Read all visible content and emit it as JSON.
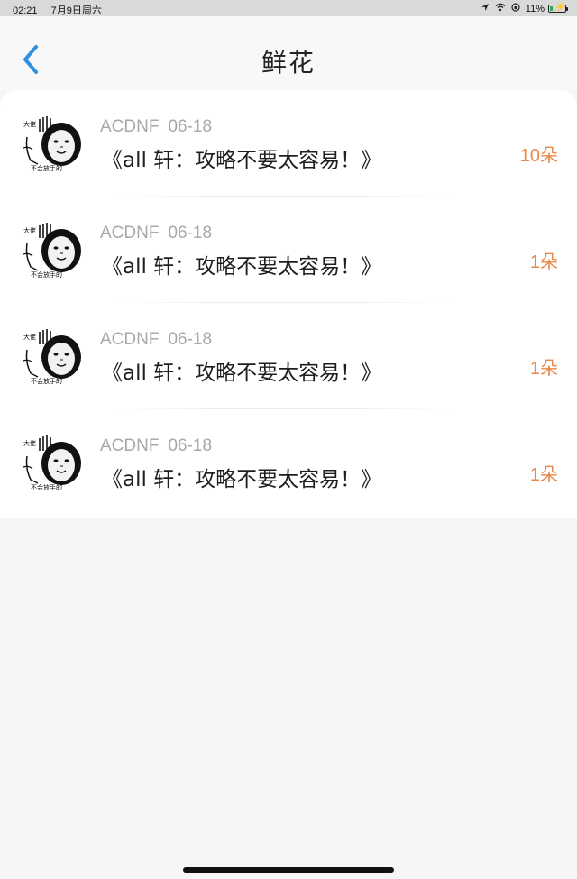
{
  "status_bar": {
    "time": "02:21",
    "date": "7月9日周六",
    "battery": "11%"
  },
  "nav": {
    "title": "鲜花"
  },
  "avatar_text": {
    "top": "大佬",
    "bottom": "不会放手的"
  },
  "items": [
    {
      "user": "ACDNF",
      "date": "06-18",
      "title": "《all 轩：攻略不要太容易！》",
      "count": "10朵"
    },
    {
      "user": "ACDNF",
      "date": "06-18",
      "title": "《all 轩：攻略不要太容易！》",
      "count": "1朵"
    },
    {
      "user": "ACDNF",
      "date": "06-18",
      "title": "《all 轩：攻略不要太容易！》",
      "count": "1朵"
    },
    {
      "user": "ACDNF",
      "date": "06-18",
      "title": "《all 轩：攻略不要太容易！》",
      "count": "1朵"
    }
  ],
  "colors": {
    "accent": "#2f8fe0",
    "count": "#e8884a",
    "meta": "#a8a8a8"
  },
  "icons": [
    "location-arrow-icon",
    "wifi-icon",
    "orientation-lock-icon",
    "battery-icon",
    "chevron-left-icon"
  ]
}
